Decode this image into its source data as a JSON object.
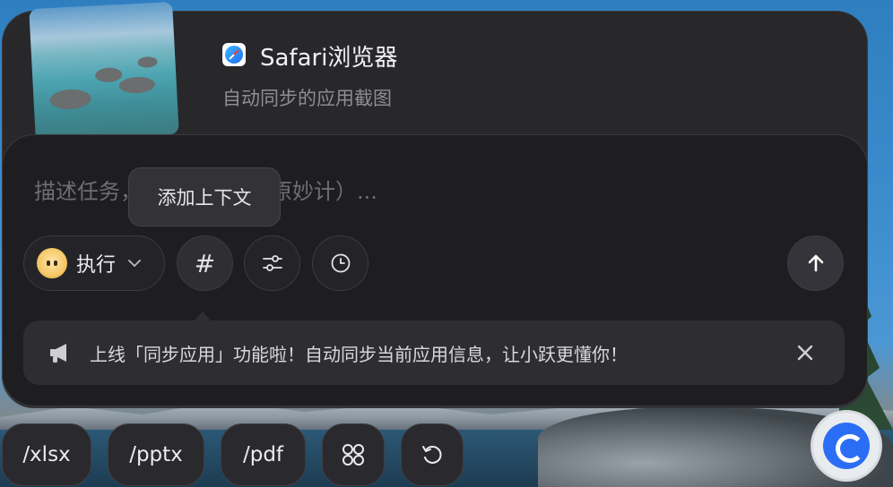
{
  "header": {
    "app_name": "Safari浏览器",
    "subtitle": "自动同步的应用截图",
    "app_icon": "safari-compass-icon"
  },
  "composer": {
    "placeholder": "描述任务，或使用技能（原妙计）...",
    "tooltip": "添加上下文"
  },
  "toolbar": {
    "mode_label": "执行",
    "mode_icon": "star-mascot-icon",
    "hash_label": "#",
    "icons": [
      "sliders-icon",
      "clock-icon",
      "arrow-up-icon"
    ]
  },
  "notice": {
    "text": "上线「同步应用」功能啦！自动同步当前应用信息，让小跃更懂你！",
    "icon": "megaphone-icon",
    "close_icon": "close-icon"
  },
  "quick_chips": {
    "xlsx": "/xlsx",
    "pptx": "/pptx",
    "pdf": "/pdf",
    "grid_icon": "grid-icon",
    "undo_icon": "undo-icon"
  },
  "colors": {
    "panel": "#28282b",
    "card": "#1e1e21",
    "accent": "#2b6ef5"
  }
}
